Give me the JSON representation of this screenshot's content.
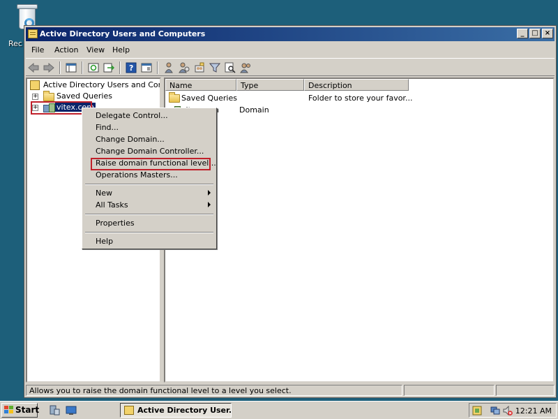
{
  "desktop": {
    "recycle_bin_label": "Rec"
  },
  "window": {
    "title": "Active Directory Users and Computers",
    "controls": {
      "minimize": "_",
      "maximize": "□",
      "close": "×"
    }
  },
  "menubar": {
    "items": [
      "File",
      "Action",
      "View",
      "Help"
    ]
  },
  "toolbar": {
    "icons": [
      "back-icon",
      "forward-icon",
      "show-hide-console-tree-icon",
      "refresh-icon",
      "export-list-icon",
      "help-icon",
      "properties-icon",
      "users-icon",
      "add-user-icon",
      "new-group-icon",
      "filter-icon",
      "find-icon",
      "add-to-group-icon"
    ]
  },
  "tree": {
    "root_label": "Active Directory Users and Comput",
    "items": [
      {
        "label": "Saved Queries",
        "expander": "+"
      },
      {
        "label": "vitex.com",
        "expander": "+"
      }
    ],
    "scroll_left": "◄",
    "scroll_right": "►"
  },
  "list": {
    "columns": [
      "Name",
      "Type",
      "Description"
    ],
    "rows": [
      {
        "name": "Saved Queries",
        "type": "",
        "description": "Folder to store your favor..."
      },
      {
        "name": "vitex.com",
        "type": "Domain",
        "description": ""
      }
    ]
  },
  "context_menu": {
    "items": [
      "Delegate Control...",
      "Find...",
      "Change Domain...",
      "Change Domain Controller...",
      "Raise domain functional level...",
      "Operations Masters...",
      "New",
      "All Tasks",
      "Properties",
      "Help"
    ],
    "highlighted": "Raise domain functional level..."
  },
  "statusbar": {
    "text": "Allows you to raise the domain functional level to a level you select."
  },
  "taskbar": {
    "start_label": "Start",
    "task_label": "Active Directory User...",
    "clock": "12:21 AM"
  },
  "colors": {
    "highlight": "#c0202a",
    "selection": "#0a246a",
    "desktop": "#1d5f7a"
  }
}
